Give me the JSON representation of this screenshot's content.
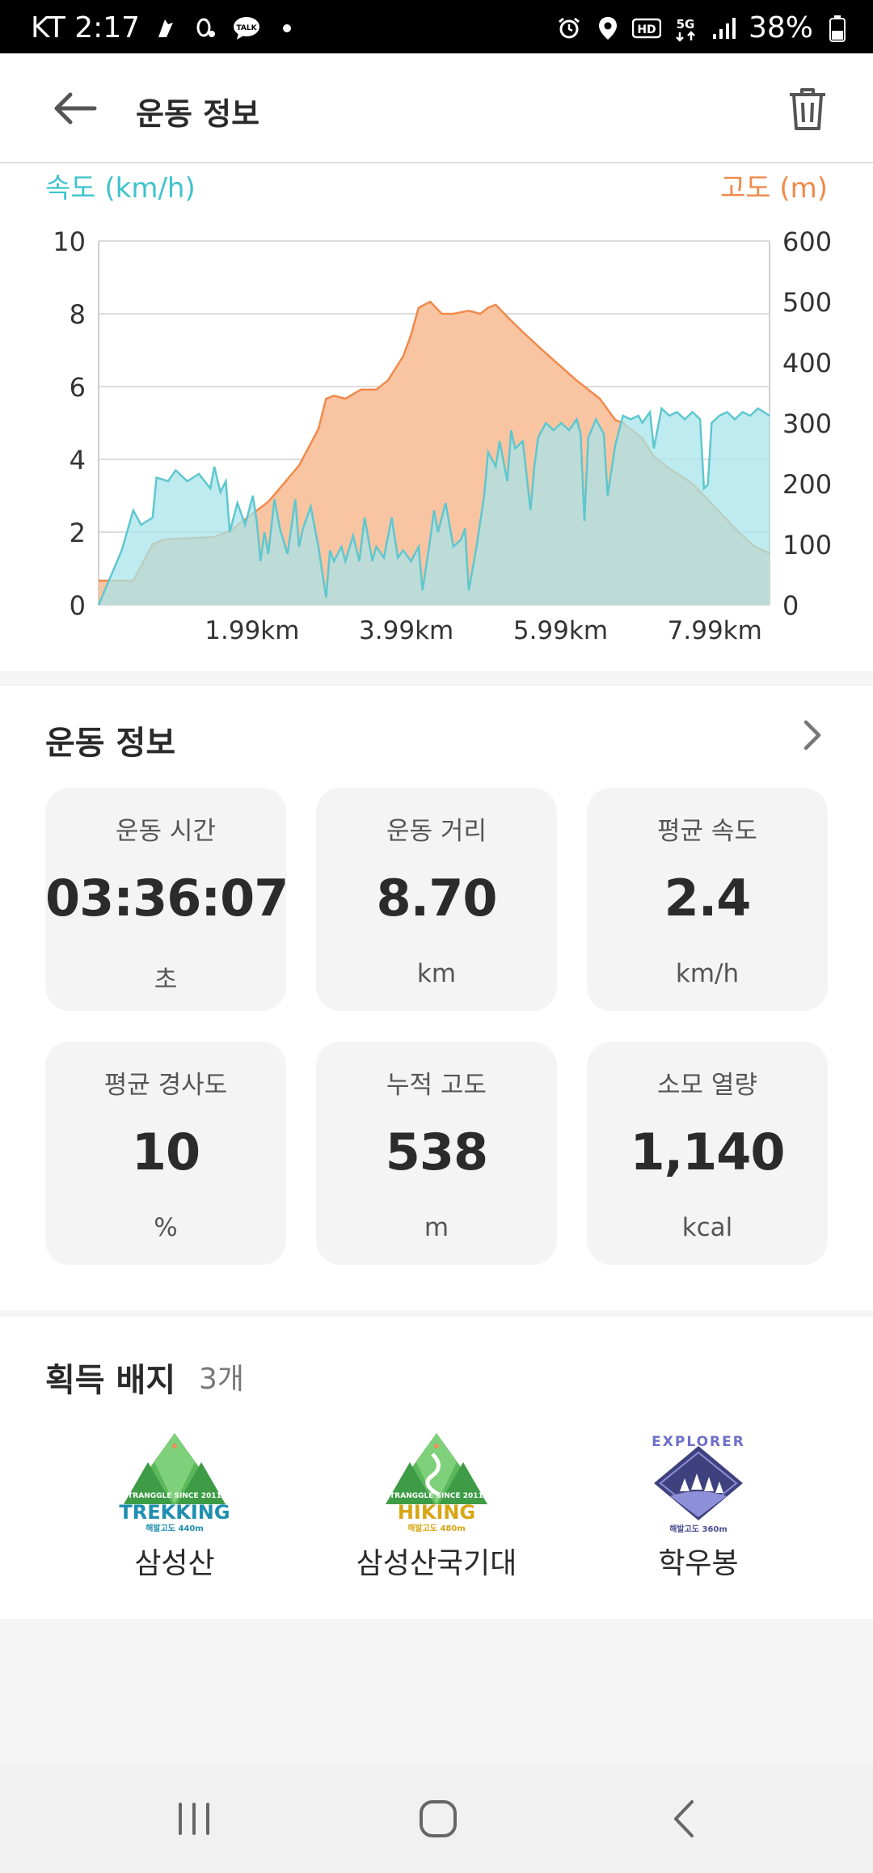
{
  "status_bar": {
    "carrier_time": "KT 2:17",
    "battery": "38%",
    "icons": [
      "location-icon",
      "alarm-icon",
      "hd-icon",
      "5g-icon",
      "signal-icon",
      "battery-icon"
    ]
  },
  "header": {
    "title": "운동 정보"
  },
  "chart_data": {
    "type": "area",
    "ylabel_left": "속도 (km/h)",
    "ylabel_right": "고도 (m)",
    "left_ticks": [
      "10",
      "8",
      "6",
      "4",
      "2",
      "0"
    ],
    "right_ticks": [
      "600",
      "500",
      "400",
      "300",
      "200",
      "100",
      "0"
    ],
    "x_ticks": [
      "1.99km",
      "3.99km",
      "5.99km",
      "7.99km"
    ],
    "ylim_left": [
      0,
      10
    ],
    "ylim_right": [
      0,
      600
    ],
    "xlim": [
      0,
      8.7
    ],
    "grid": true,
    "series": [
      {
        "name": "고도 (m)",
        "axis": "right",
        "color": "#f08a4b",
        "fill": "#f9c4a2",
        "points": [
          [
            0,
            40
          ],
          [
            0.45,
            40
          ],
          [
            0.7,
            100
          ],
          [
            0.85,
            108
          ],
          [
            1.5,
            112
          ],
          [
            1.7,
            122
          ],
          [
            2.2,
            170
          ],
          [
            2.6,
            230
          ],
          [
            2.85,
            290
          ],
          [
            2.95,
            340
          ],
          [
            3.05,
            345
          ],
          [
            3.2,
            340
          ],
          [
            3.4,
            355
          ],
          [
            3.6,
            355
          ],
          [
            3.75,
            370
          ],
          [
            3.95,
            410
          ],
          [
            4.05,
            445
          ],
          [
            4.15,
            490
          ],
          [
            4.3,
            500
          ],
          [
            4.45,
            480
          ],
          [
            4.6,
            480
          ],
          [
            4.8,
            485
          ],
          [
            4.95,
            480
          ],
          [
            5.05,
            490
          ],
          [
            5.15,
            495
          ],
          [
            5.3,
            475
          ],
          [
            5.5,
            450
          ],
          [
            5.8,
            415
          ],
          [
            6.2,
            370
          ],
          [
            6.5,
            340
          ],
          [
            6.7,
            305
          ],
          [
            6.8,
            300
          ],
          [
            7.05,
            275
          ],
          [
            7.2,
            245
          ],
          [
            7.4,
            225
          ],
          [
            7.7,
            200
          ],
          [
            8.0,
            160
          ],
          [
            8.3,
            120
          ],
          [
            8.5,
            97
          ],
          [
            8.7,
            85
          ]
        ]
      },
      {
        "name": "속도 (km/h)",
        "axis": "left",
        "color": "#5ec7cf",
        "fill": "#a8e4ea",
        "points": [
          [
            0,
            0
          ],
          [
            0.3,
            1.5
          ],
          [
            0.45,
            2.6
          ],
          [
            0.55,
            2.2
          ],
          [
            0.7,
            2.4
          ],
          [
            0.75,
            3.5
          ],
          [
            0.9,
            3.4
          ],
          [
            1.0,
            3.7
          ],
          [
            1.15,
            3.4
          ],
          [
            1.3,
            3.6
          ],
          [
            1.45,
            3.2
          ],
          [
            1.5,
            3.8
          ],
          [
            1.58,
            3.1
          ],
          [
            1.65,
            3.4
          ],
          [
            1.7,
            2.0
          ],
          [
            1.8,
            2.8
          ],
          [
            1.9,
            2.2
          ],
          [
            2.0,
            3.0
          ],
          [
            2.05,
            2.3
          ],
          [
            2.1,
            1.2
          ],
          [
            2.15,
            2.0
          ],
          [
            2.2,
            1.4
          ],
          [
            2.28,
            2.9
          ],
          [
            2.35,
            2.1
          ],
          [
            2.45,
            1.4
          ],
          [
            2.55,
            2.9
          ],
          [
            2.6,
            1.6
          ],
          [
            2.65,
            2.1
          ],
          [
            2.75,
            2.7
          ],
          [
            2.85,
            1.6
          ],
          [
            2.95,
            0.2
          ],
          [
            3.0,
            1.5
          ],
          [
            3.05,
            1.2
          ],
          [
            3.15,
            1.6
          ],
          [
            3.2,
            1.2
          ],
          [
            3.3,
            1.9
          ],
          [
            3.38,
            1.2
          ],
          [
            3.45,
            2.4
          ],
          [
            3.55,
            1.2
          ],
          [
            3.6,
            1.6
          ],
          [
            3.7,
            1.3
          ],
          [
            3.8,
            2.4
          ],
          [
            3.88,
            1.3
          ],
          [
            3.95,
            1.5
          ],
          [
            4.05,
            1.2
          ],
          [
            4.15,
            1.6
          ],
          [
            4.2,
            0.4
          ],
          [
            4.3,
            1.8
          ],
          [
            4.35,
            2.6
          ],
          [
            4.4,
            2.0
          ],
          [
            4.5,
            2.8
          ],
          [
            4.6,
            1.6
          ],
          [
            4.7,
            1.8
          ],
          [
            4.75,
            2.1
          ],
          [
            4.8,
            0.4
          ],
          [
            4.9,
            1.6
          ],
          [
            5.0,
            3.0
          ],
          [
            5.05,
            4.2
          ],
          [
            5.15,
            3.8
          ],
          [
            5.2,
            4.5
          ],
          [
            5.3,
            3.4
          ],
          [
            5.35,
            4.8
          ],
          [
            5.4,
            4.3
          ],
          [
            5.5,
            4.5
          ],
          [
            5.6,
            2.6
          ],
          [
            5.65,
            3.8
          ],
          [
            5.7,
            4.6
          ],
          [
            5.8,
            5.0
          ],
          [
            5.9,
            4.8
          ],
          [
            6.0,
            5.0
          ],
          [
            6.1,
            4.8
          ],
          [
            6.2,
            5.1
          ],
          [
            6.25,
            4.7
          ],
          [
            6.3,
            2.3
          ],
          [
            6.35,
            4.6
          ],
          [
            6.45,
            5.1
          ],
          [
            6.55,
            4.7
          ],
          [
            6.6,
            3.0
          ],
          [
            6.7,
            4.4
          ],
          [
            6.8,
            5.2
          ],
          [
            6.9,
            5.1
          ],
          [
            7.0,
            5.2
          ],
          [
            7.05,
            5.0
          ],
          [
            7.15,
            5.3
          ],
          [
            7.2,
            4.3
          ],
          [
            7.3,
            5.4
          ],
          [
            7.4,
            5.2
          ],
          [
            7.5,
            5.3
          ],
          [
            7.6,
            5.1
          ],
          [
            7.7,
            5.3
          ],
          [
            7.8,
            5.1
          ],
          [
            7.85,
            3.2
          ],
          [
            7.9,
            3.3
          ],
          [
            7.95,
            5.0
          ],
          [
            8.05,
            5.2
          ],
          [
            8.15,
            5.3
          ],
          [
            8.25,
            5.1
          ],
          [
            8.35,
            5.3
          ],
          [
            8.45,
            5.2
          ],
          [
            8.55,
            5.4
          ],
          [
            8.7,
            5.2
          ]
        ]
      }
    ]
  },
  "workout_section": {
    "title": "운동 정보",
    "stats": [
      {
        "label": "운동 시간",
        "value": "03:36:07",
        "unit": "초"
      },
      {
        "label": "운동 거리",
        "value": "8.70",
        "unit": "km"
      },
      {
        "label": "평균 속도",
        "value": "2.4",
        "unit": "km/h"
      },
      {
        "label": "평균 경사도",
        "value": "10",
        "unit": "%"
      },
      {
        "label": "누적 고도",
        "value": "538",
        "unit": "m"
      },
      {
        "label": "소모 열량",
        "value": "1,140",
        "unit": "kcal"
      }
    ]
  },
  "badges_section": {
    "title": "획득 배지",
    "count": "3개",
    "badges": [
      {
        "name": "삼성산",
        "word": "TREKKING",
        "top_text": "TRANGGLE SINCE 2011",
        "sub_text": "해발고도 440m",
        "accent": "#1f8fb0"
      },
      {
        "name": "삼성산국기대",
        "word": "HIKING",
        "top_text": "TRANGGLE SINCE 2011",
        "sub_text": "해발고도 480m",
        "accent": "#d8a514"
      },
      {
        "name": "학우봉",
        "word": "EXPLORER",
        "sub_text": "해발고도 360m",
        "accent": "#4a4c93"
      }
    ]
  }
}
